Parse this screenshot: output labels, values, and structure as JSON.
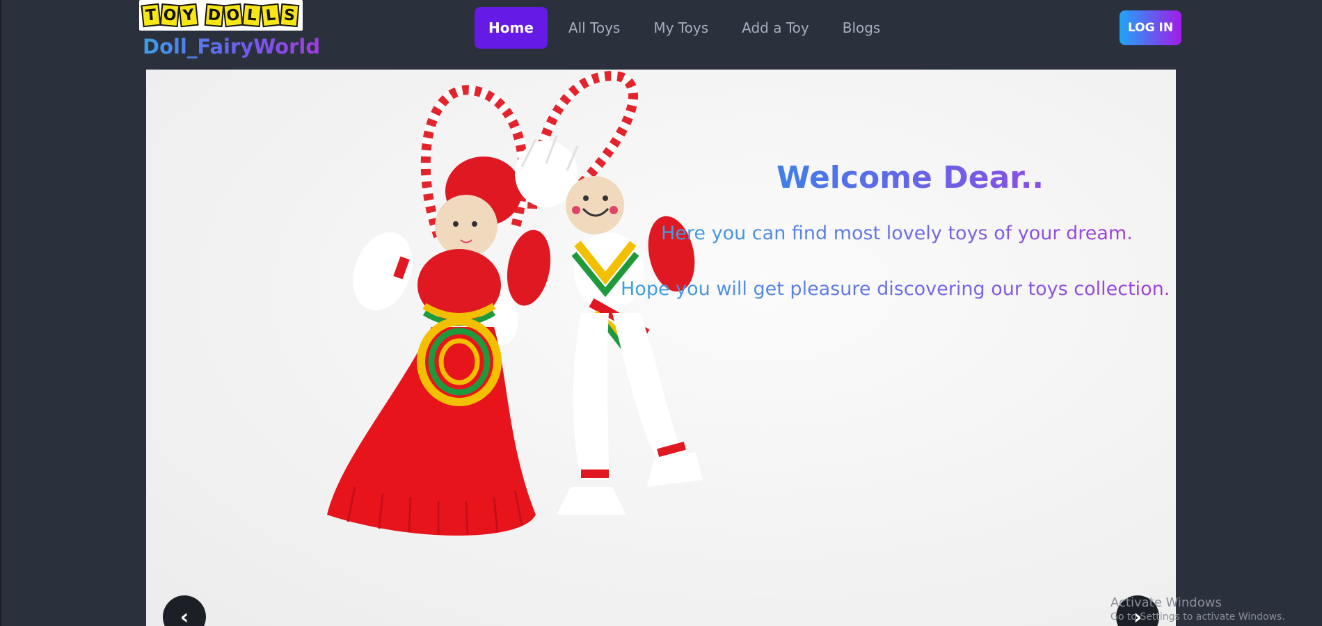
{
  "brand": {
    "logo_letters": [
      "T",
      "O",
      "Y",
      "D",
      "O",
      "L",
      "L",
      "S"
    ],
    "logo_text": "TOY DOLLS",
    "name": "Doll_FairyWorld"
  },
  "nav": {
    "items": [
      {
        "label": "Home",
        "active": true
      },
      {
        "label": "All Toys",
        "active": false
      },
      {
        "label": "My Toys",
        "active": false
      },
      {
        "label": "Add a Toy",
        "active": false
      },
      {
        "label": "Blogs",
        "active": false
      }
    ],
    "login_label": "LOG IN"
  },
  "hero": {
    "title": "Welcome Dear..",
    "line1": "Here you can find most lovely toys of your dream.",
    "line2": "Hope you will get pleasure discovering our toys collection.",
    "prev_icon": "‹",
    "next_icon": "›",
    "image_alt": "two yarn martenitsa dolls in red and white"
  },
  "watermark": {
    "title": "Activate Windows",
    "subtitle": "Go to Settings to activate Windows."
  },
  "colors": {
    "background": "#2a303c",
    "active_nav": "#661ae6",
    "login_gradient_start": "#1fa6f5",
    "login_gradient_end": "#a11be8"
  }
}
